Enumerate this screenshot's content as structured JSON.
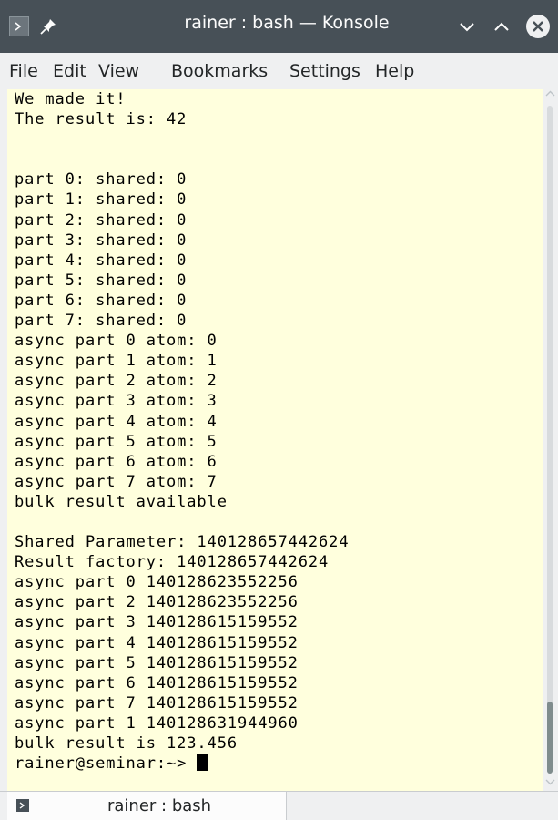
{
  "window": {
    "title": "rainer : bash — Konsole"
  },
  "icons": {
    "app": "konsole-icon",
    "pin": "pin-icon",
    "minimize": "chevron-down-icon",
    "maximize": "chevron-up-icon",
    "close": "close-icon"
  },
  "menu": {
    "items": [
      "File",
      "Edit",
      "View",
      "Bookmarks",
      "Settings",
      "Help"
    ]
  },
  "terminal": {
    "output": "We made it!\nThe result is: 42\n\n\npart 0: shared: 0\npart 1: shared: 0\npart 2: shared: 0\npart 3: shared: 0\npart 4: shared: 0\npart 5: shared: 0\npart 6: shared: 0\npart 7: shared: 0\nasync part 0 atom: 0\nasync part 1 atom: 1\nasync part 2 atom: 2\nasync part 3 atom: 3\nasync part 4 atom: 4\nasync part 5 atom: 5\nasync part 6 atom: 6\nasync part 7 atom: 7\nbulk result available\n\nShared Parameter: 140128657442624\nResult factory: 140128657442624\nasync part 0 140128623552256\nasync part 2 140128623552256\nasync part 3 140128615159552\nasync part 4 140128615159552\nasync part 5 140128615159552\nasync part 6 140128615159552\nasync part 7 140128615159552\nasync part 1 140128631944960\nbulk result is 123.456",
    "prompt": "rainer@seminar:~> ",
    "background": "#ffffdd"
  },
  "tabs": [
    {
      "label": "rainer : bash"
    }
  ],
  "colors": {
    "titlebar": "#475057",
    "window_bg": "#eff0f1"
  }
}
